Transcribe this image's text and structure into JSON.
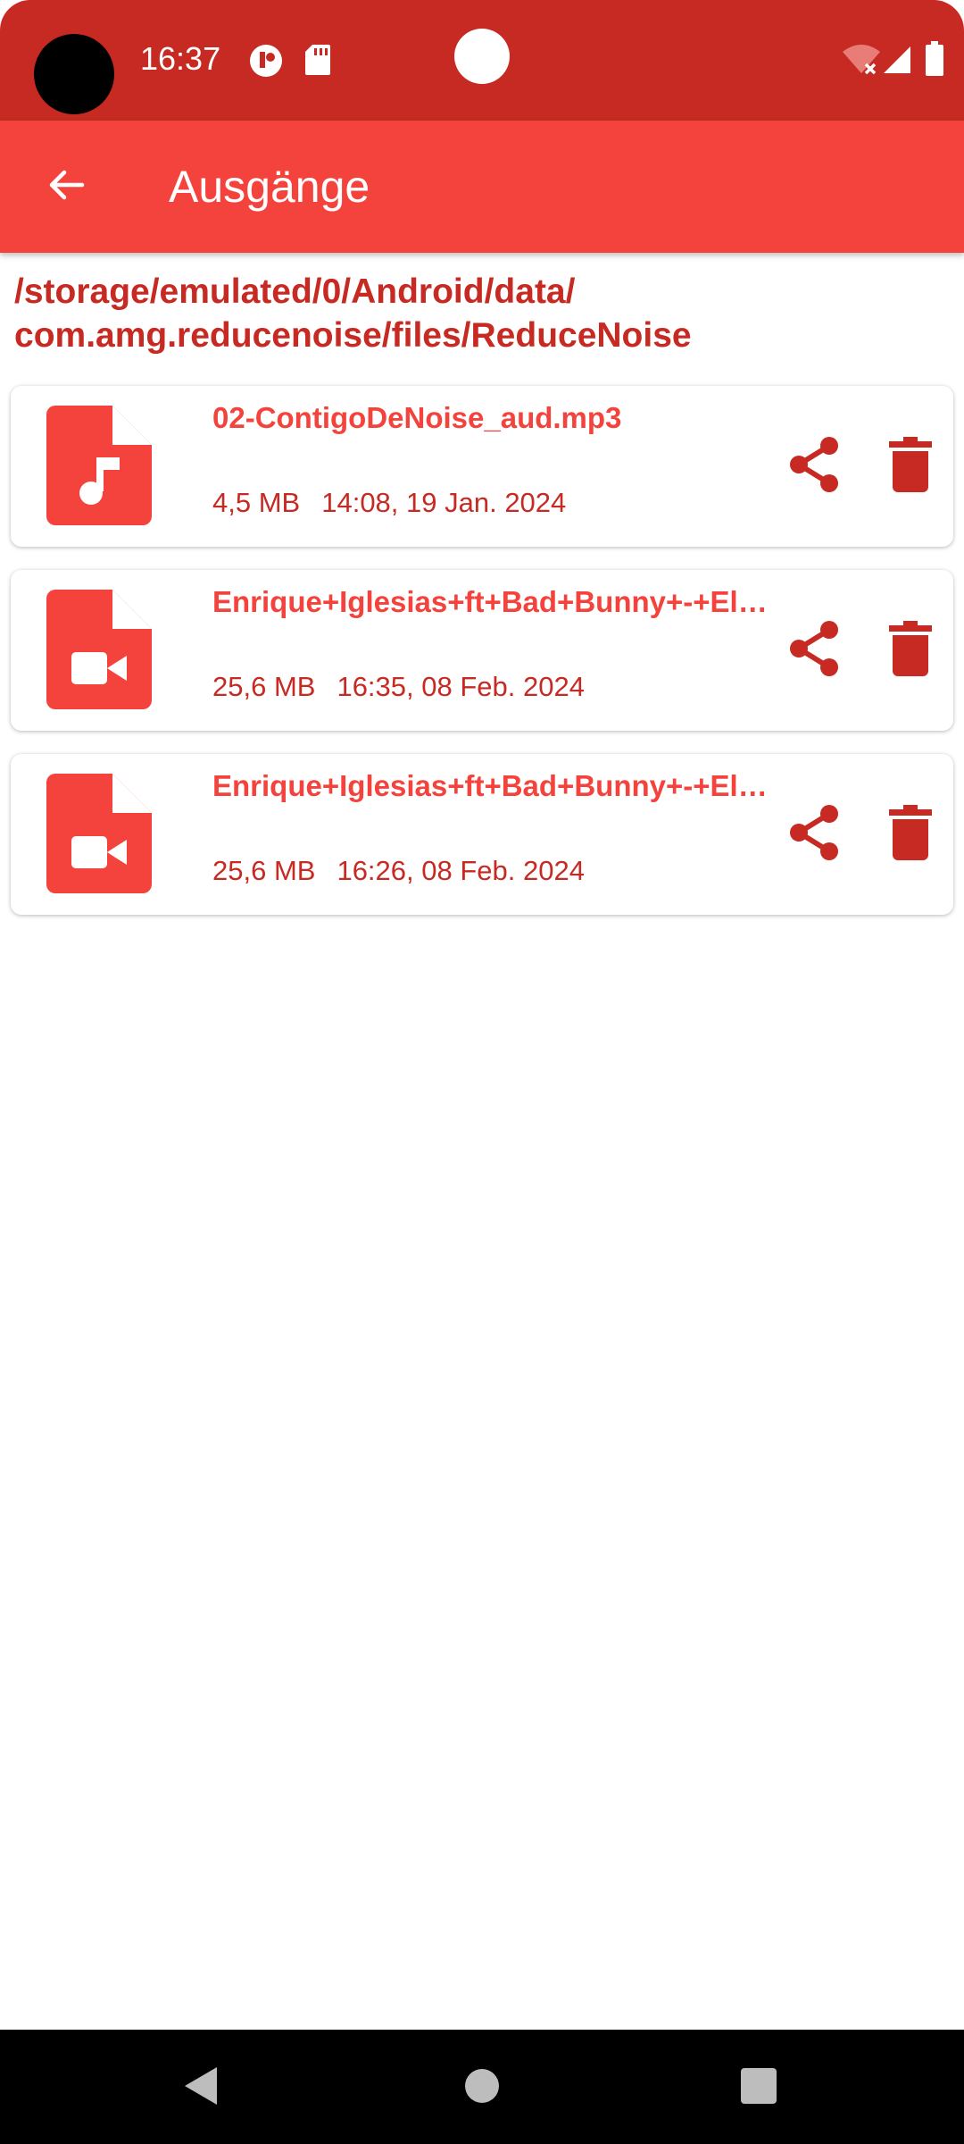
{
  "status_bar": {
    "time": "16:37",
    "icons": [
      "app-notification-icon",
      "sd-card-icon",
      "wifi-off-icon",
      "signal-icon",
      "battery-icon"
    ]
  },
  "app_bar": {
    "title": "Ausgänge",
    "back_icon": "arrow-back-icon"
  },
  "folder_path": "/storage/emulated/0/Android/data/\ncom.amg.reducenoise/files/ReduceNoise",
  "files": [
    {
      "type": "audio",
      "icon": "audio-file-icon",
      "name": "02-ContigoDeNoise_aud.mp3",
      "size": "4,5 MB",
      "date": "14:08, 19 Jan. 2024"
    },
    {
      "type": "video",
      "icon": "video-file-icon",
      "name": "Enrique+Iglesias+ft+Bad+Bunny+-+El+…",
      "size": "25,6 MB",
      "date": "16:35, 08 Feb. 2024"
    },
    {
      "type": "video",
      "icon": "video-file-icon",
      "name": "Enrique+Iglesias+ft+Bad+Bunny+-+El+…",
      "size": "25,6 MB",
      "date": "16:26, 08 Feb. 2024"
    }
  ],
  "colors": {
    "primary": "#f4433c",
    "primary_dark": "#c62a22",
    "background": "#ffffff"
  },
  "nav_bar": {
    "icons": [
      "nav-back-icon",
      "nav-home-icon",
      "nav-recents-icon"
    ]
  }
}
